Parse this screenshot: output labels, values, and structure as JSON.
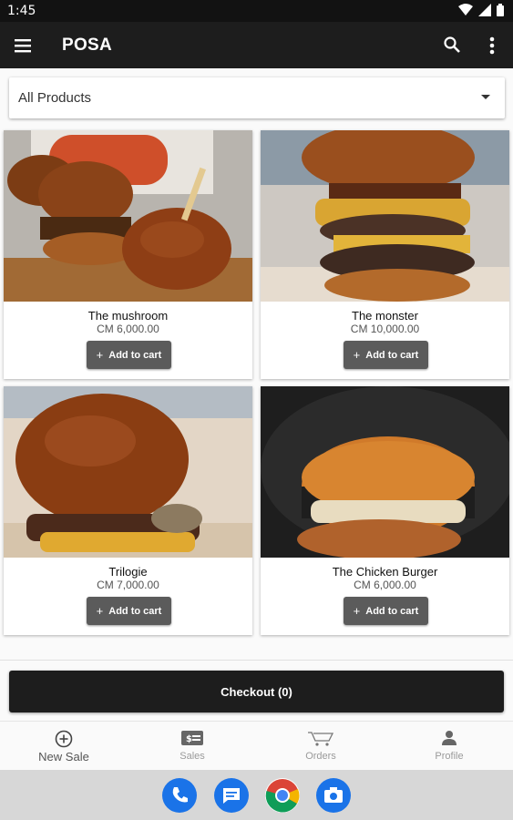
{
  "status_bar": {
    "time": "1:45"
  },
  "app_bar": {
    "title": "POSA",
    "menu_icon": "menu-icon",
    "search_icon": "search-icon",
    "more_icon": "more-vert-icon"
  },
  "filter": {
    "selected": "All Products",
    "caret_icon": "arrow-drop-down-icon"
  },
  "products": [
    {
      "name": "The mushroom",
      "price": "CM 6,000.00",
      "add_label": "Add to cart"
    },
    {
      "name": "The monster",
      "price": "CM 10,000.00",
      "add_label": "Add to cart"
    },
    {
      "name": "Trilogie",
      "price": "CM 7,000.00",
      "add_label": "Add to cart"
    },
    {
      "name": "The Chicken Burger",
      "price": "CM 6,000.00",
      "add_label": "Add to cart"
    }
  ],
  "add_button_plus": "+",
  "checkout": {
    "label": "Checkout (0)"
  },
  "bottom_nav": [
    {
      "label": "New Sale",
      "icon": "add-circle-icon",
      "active": true
    },
    {
      "label": "Sales",
      "icon": "receipt-dollar-icon",
      "active": false
    },
    {
      "label": "Orders",
      "icon": "shopping-cart-icon",
      "active": false
    },
    {
      "label": "Profile",
      "icon": "person-icon",
      "active": false
    }
  ],
  "dock_apps": [
    "phone-app-icon",
    "messages-app-icon",
    "chrome-app-icon",
    "camera-app-icon"
  ],
  "colors": {
    "app_bar": "#1d1d1d",
    "button": "#5b5b5b",
    "checkout": "#1d1d1d"
  }
}
